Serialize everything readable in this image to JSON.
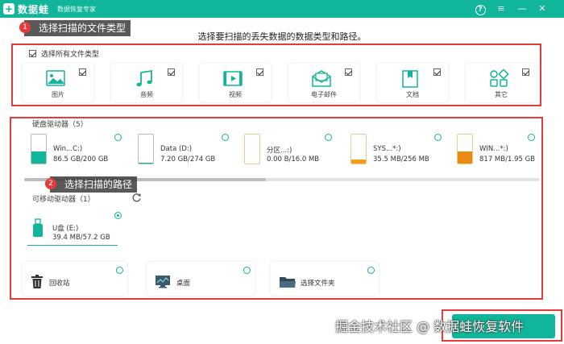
{
  "app": {
    "name": "数据蛙",
    "subtitle": "数据恢复专家",
    "logo_char": "+"
  },
  "window_controls": {
    "help": "?",
    "menu": "≡",
    "minimize": "—",
    "close": "✕"
  },
  "annotations": [
    {
      "number": "1",
      "text": "选择扫描的文件类型"
    },
    {
      "number": "2",
      "text": "选择扫描的路径"
    }
  ],
  "instruction": "选择要扫描的丢失数据的数据类型和路径。",
  "select_all": {
    "label": "选择所有文件类型",
    "checked": true
  },
  "file_types": [
    {
      "label": "图片",
      "icon": "image-icon",
      "checked": true
    },
    {
      "label": "音频",
      "icon": "music-icon",
      "checked": true
    },
    {
      "label": "视频",
      "icon": "video-icon",
      "checked": true
    },
    {
      "label": "电子邮件",
      "icon": "email-icon",
      "checked": true
    },
    {
      "label": "文档",
      "icon": "document-icon",
      "checked": true
    },
    {
      "label": "其它",
      "icon": "other-icon",
      "checked": true
    }
  ],
  "hard_drives": {
    "title": "硬盘驱动器（5）",
    "items": [
      {
        "name": "Win...C:)",
        "size": "86.5 GB/200 GB",
        "used_fraction": 0.43,
        "color": "#11b59a"
      },
      {
        "name": "Data (D:)",
        "size": "7.20 GB/274 GB",
        "used_fraction": 0.03,
        "color": "#11b59a"
      },
      {
        "name": "分区...:)",
        "size": "0.00  B/16.0 MB",
        "used_fraction": 0.0,
        "color": "#f29b1d"
      },
      {
        "name": "SYS...*:)",
        "size": "35.5 MB/256 MB",
        "used_fraction": 0.14,
        "color": "#f29b1d"
      },
      {
        "name": "WIN...*:)",
        "size": "817 MB/1.95 GB",
        "used_fraction": 0.42,
        "color": "#e98a14"
      }
    ]
  },
  "removable": {
    "title": "可移动驱动器（1）",
    "refresh_icon": "refresh-icon",
    "items": [
      {
        "name": "U盘 (E:)",
        "size": "39.4 MB/57.2 GB"
      }
    ]
  },
  "locations": [
    {
      "label": "回收站",
      "icon": "trash-icon"
    },
    {
      "label": "桌面",
      "icon": "desktop-icon"
    },
    {
      "label": "选择文件夹",
      "icon": "folder-icon"
    }
  ],
  "watermark": "掘金技术社区 @ 数据蛙恢复软件",
  "colors": {
    "brand": "#11b59a",
    "annotation": "#e63b3b",
    "warning": "#f29b1d"
  }
}
